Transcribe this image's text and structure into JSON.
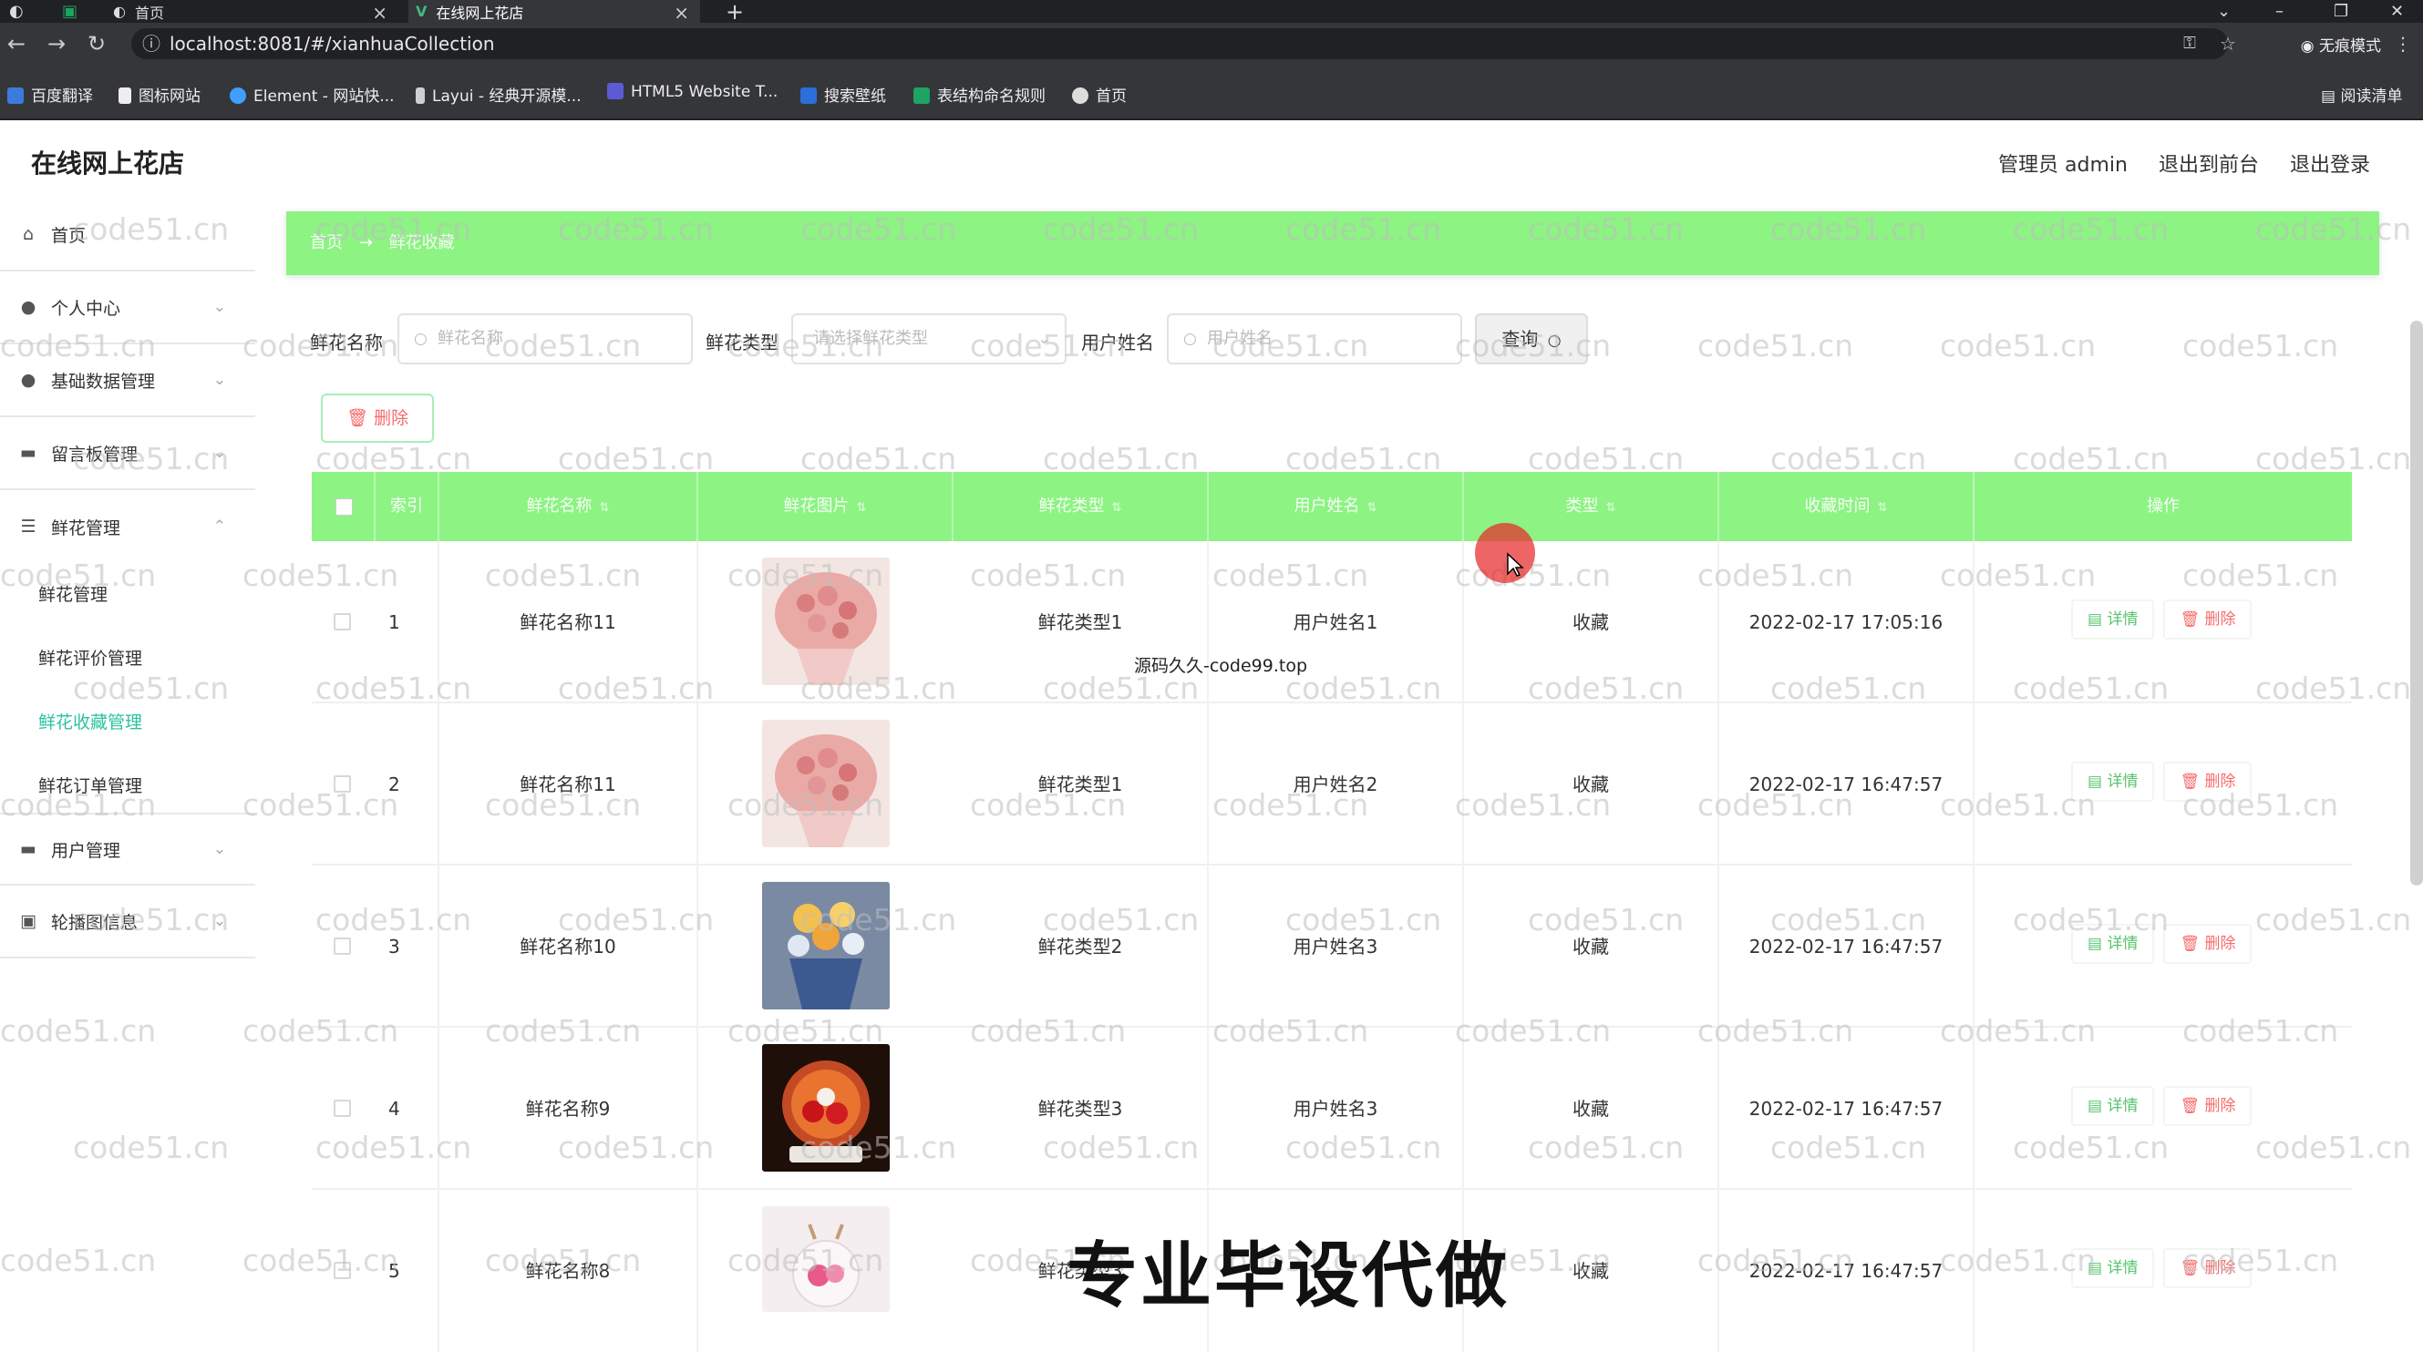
{
  "browser": {
    "tabs": [
      {
        "label": ""
      },
      {
        "label": "首页"
      },
      {
        "label": "在线网上花店"
      }
    ],
    "url": "localhost:8081/#/xianhuaCollection",
    "incognito_label": "无痕模式",
    "reading_list_label": "阅读清单",
    "bookmarks": [
      {
        "label": "百度翻译"
      },
      {
        "label": "图标网站"
      },
      {
        "label": "Element - 网站快..."
      },
      {
        "label": "Layui - 经典开源模..."
      },
      {
        "label": "HTML5 Website T..."
      },
      {
        "label": "搜索壁纸"
      },
      {
        "label": "表结构命名规则"
      },
      {
        "label": "首页"
      }
    ]
  },
  "app": {
    "title": "在线网上花店",
    "admin_label": "管理员 admin",
    "back_front_label": "退出到前台",
    "logout_label": "退出登录"
  },
  "sidebar": {
    "items": [
      {
        "label": "首页",
        "icon": "home-icon"
      },
      {
        "label": "个人中心",
        "icon": "user-icon"
      },
      {
        "label": "基础数据管理",
        "icon": "user-icon"
      },
      {
        "label": "留言板管理",
        "icon": "message-icon"
      },
      {
        "label": "鲜花管理",
        "icon": "list-icon"
      },
      {
        "label": "用户管理",
        "icon": "user-group-icon"
      },
      {
        "label": "轮播图信息",
        "icon": "comment-icon"
      }
    ],
    "subitems": [
      {
        "label": "鲜花管理"
      },
      {
        "label": "鲜花评价管理"
      },
      {
        "label": "鲜花收藏管理"
      },
      {
        "label": "鲜花订单管理"
      }
    ]
  },
  "breadcrumb": {
    "home": "首页",
    "current": "鲜花收藏"
  },
  "filters": {
    "name_label": "鲜花名称",
    "name_placeholder": "鲜花名称",
    "type_label": "鲜花类型",
    "type_placeholder": "请选择鲜花类型",
    "user_label": "用户姓名",
    "user_placeholder": "用户姓名",
    "query_label": "查询"
  },
  "actions": {
    "delete_label": "删除"
  },
  "table": {
    "headers": [
      "索引",
      "鲜花名称",
      "鲜花图片",
      "鲜花类型",
      "用户姓名",
      "类型",
      "收藏时间",
      "操作"
    ],
    "detail_label": "详情",
    "delete_label": "删除",
    "rows": [
      {
        "index": "1",
        "name": "鲜花名称11",
        "type": "鲜花类型1",
        "user": "用户姓名1",
        "kind": "收藏",
        "time": "2022-02-17 17:05:16"
      },
      {
        "index": "2",
        "name": "鲜花名称11",
        "type": "鲜花类型1",
        "user": "用户姓名2",
        "kind": "收藏",
        "time": "2022-02-17 16:47:57"
      },
      {
        "index": "3",
        "name": "鲜花名称10",
        "type": "鲜花类型2",
        "user": "用户姓名3",
        "kind": "收藏",
        "time": "2022-02-17 16:47:57"
      },
      {
        "index": "4",
        "name": "鲜花名称9",
        "type": "鲜花类型3",
        "user": "用户姓名3",
        "kind": "收藏",
        "time": "2022-02-17 16:47:57"
      },
      {
        "index": "5",
        "name": "鲜花名称8",
        "type": "鲜花类型3",
        "user": "",
        "kind": "收藏",
        "time": "2022-02-17 16:47:57"
      }
    ]
  },
  "watermark": "code51.cn",
  "overlay": {
    "label": "源码久久-code99.top",
    "banner": "专业毕设代做"
  },
  "colors": {
    "accent_green": "#8df383",
    "active_submenu": "#2cc2a2",
    "danger": "#f56c6c",
    "success": "#56c46b"
  }
}
